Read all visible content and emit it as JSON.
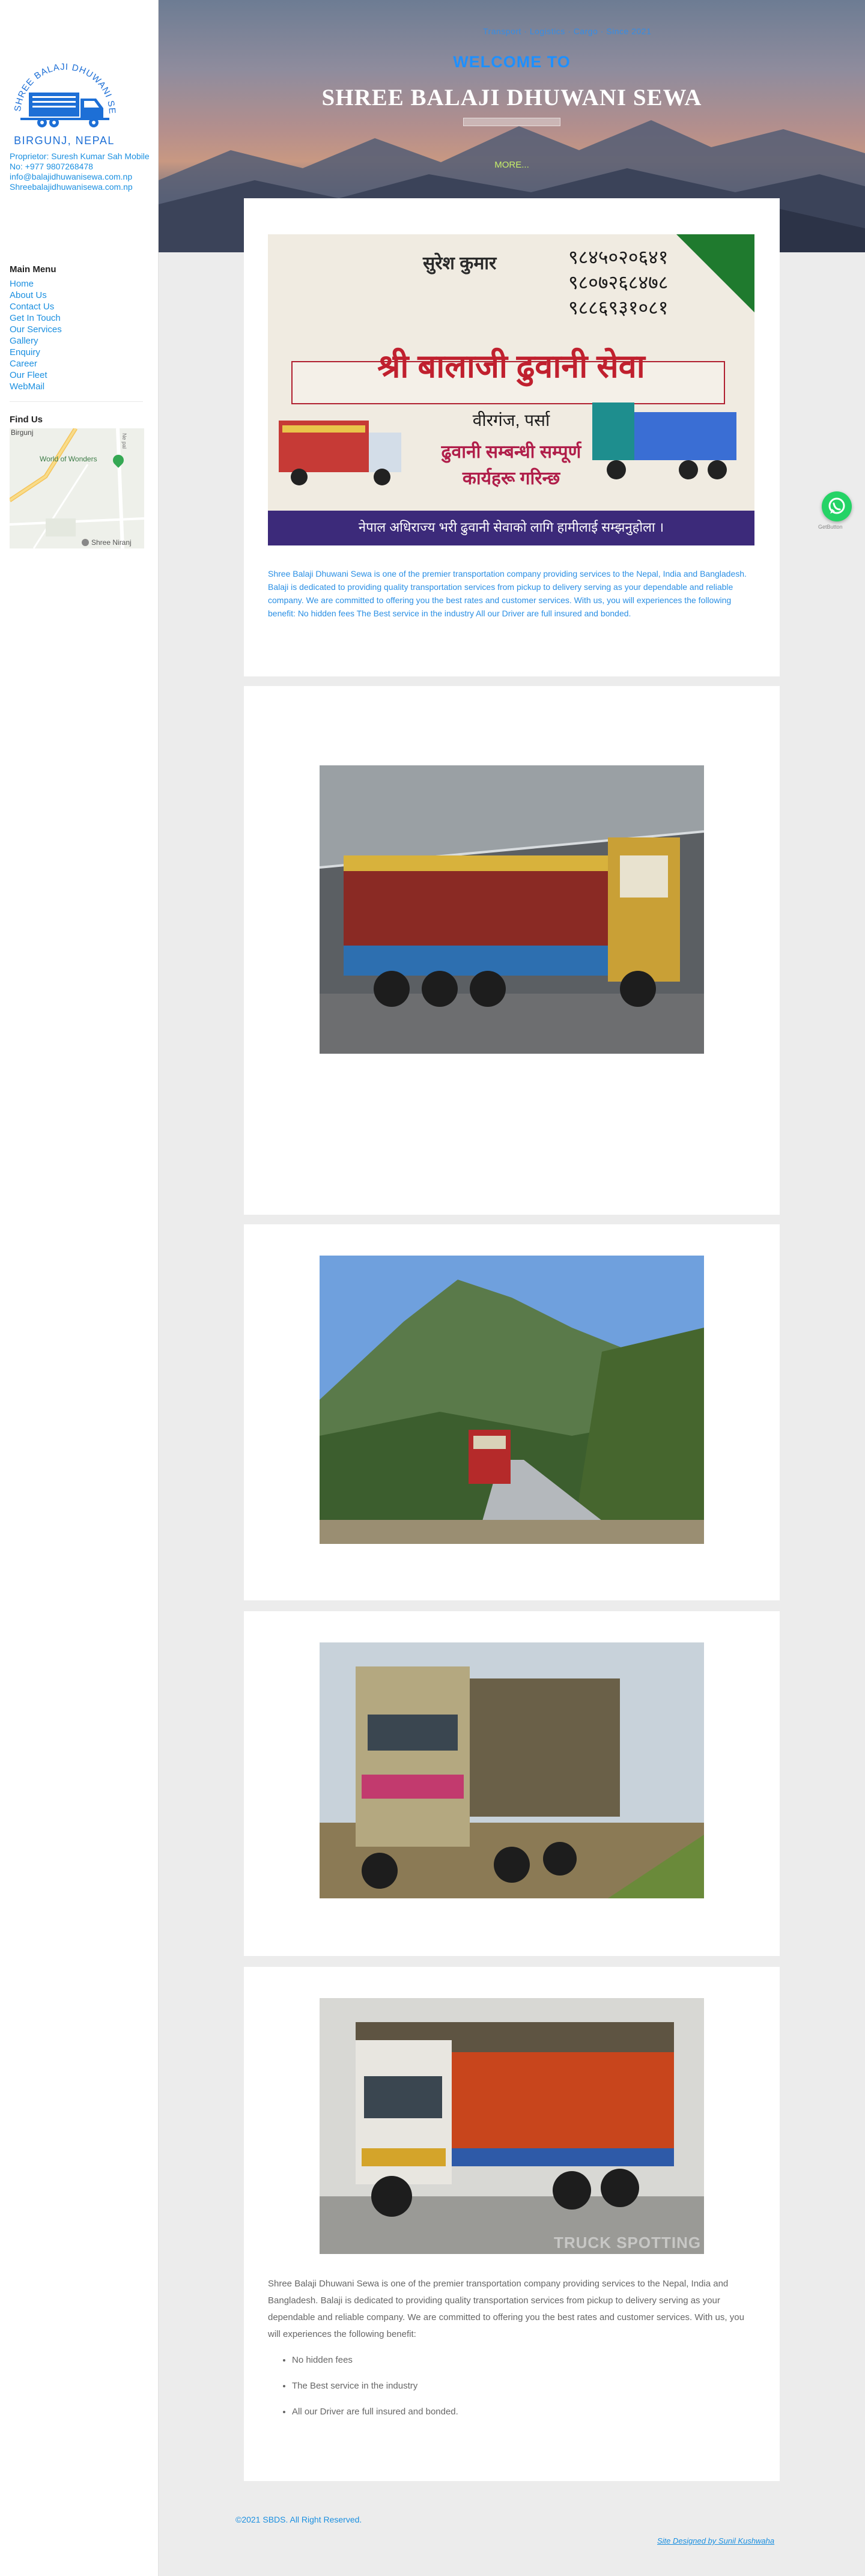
{
  "brand": {
    "logo_arc_text": "SHREE BALAJI DHUWANI SEWA",
    "logo_location": "BIRGUNJ, NEPAL",
    "colors": {
      "accent": "#1a8fe0",
      "logo_blue": "#1d6fd6",
      "whatsapp": "#25d366"
    }
  },
  "sidebar": {
    "contact_lines": [
      "Proprietor: Suresh Kumar Sah Mobile",
      "No: +977 9807268478",
      "info@balajidhuwanisewa.com.np",
      "Shreebalajidhuwanisewa.com.np"
    ],
    "menu_title": "Main Menu",
    "menu": [
      "Home",
      "About Us",
      "Contact Us",
      "Get In Touch",
      "Our Services",
      "Gallery",
      "Enquiry",
      "Career",
      "Our Fleet",
      "WebMail"
    ],
    "findus_title": "Find Us",
    "map": {
      "label_city": "Birgunj",
      "label_poi": "World of Wonders",
      "label_shree": "Shree Niranj",
      "road_label": "Ne pal"
    }
  },
  "hero": {
    "tagline": "Transport · Logistics · Cargo · Since 2021",
    "welcome": "WELCOME TO",
    "title": "SHREE BALAJI DHUWANI SEWA",
    "more": "MORE..."
  },
  "sign": {
    "name": "सुरेश कुमार",
    "phones": [
      "९८४५०२०६४१",
      "९८०७२६८४७८",
      "९८८६९३१०८१"
    ],
    "company": "श्री बालाजी ढुवानी सेवा",
    "town": "वीरगंज, पर्सा",
    "line1": "ढुवानी सम्बन्धी सम्पूर्ण",
    "line2": "कार्यहरू गरिन्छ",
    "footer": "नेपाल अधिराज्य भरी ढुवानी सेवाको लागि हामीलाई सम्झनुहोला ।"
  },
  "about_blue": "Shree Balaji Dhuwani Sewa is one of the premier transportation company providing services to the Nepal, India and Bangladesh. Balaji is dedicated to providing quality transportation services from pickup to delivery serving as your dependable and reliable company. We are committed to offering you the best rates and customer services. With us, you will experiences the following benefit: No hidden fees The Best service in the industry All our Driver are full insured and bonded.",
  "about_gray": "Shree Balaji Dhuwani Sewa is one of the premier transportation company providing services to the Nepal, India and Bangladesh. Balaji is dedicated to providing quality transportation services from pickup to delivery serving as your dependable and reliable company. We are committed to offering you the best rates and customer services. With us, you will experiences the following benefit:",
  "benefits": [
    "No hidden fees",
    "The Best service in the industry",
    "All our Driver are full insured and bonded."
  ],
  "watermark": "TRUCK SPOTTING",
  "footer": {
    "copyright": "©2021 SBDS. All Right Reserved.",
    "credit": "Site Designed by Sunil Kushwaha"
  },
  "whatsapp_label": "GetButton"
}
